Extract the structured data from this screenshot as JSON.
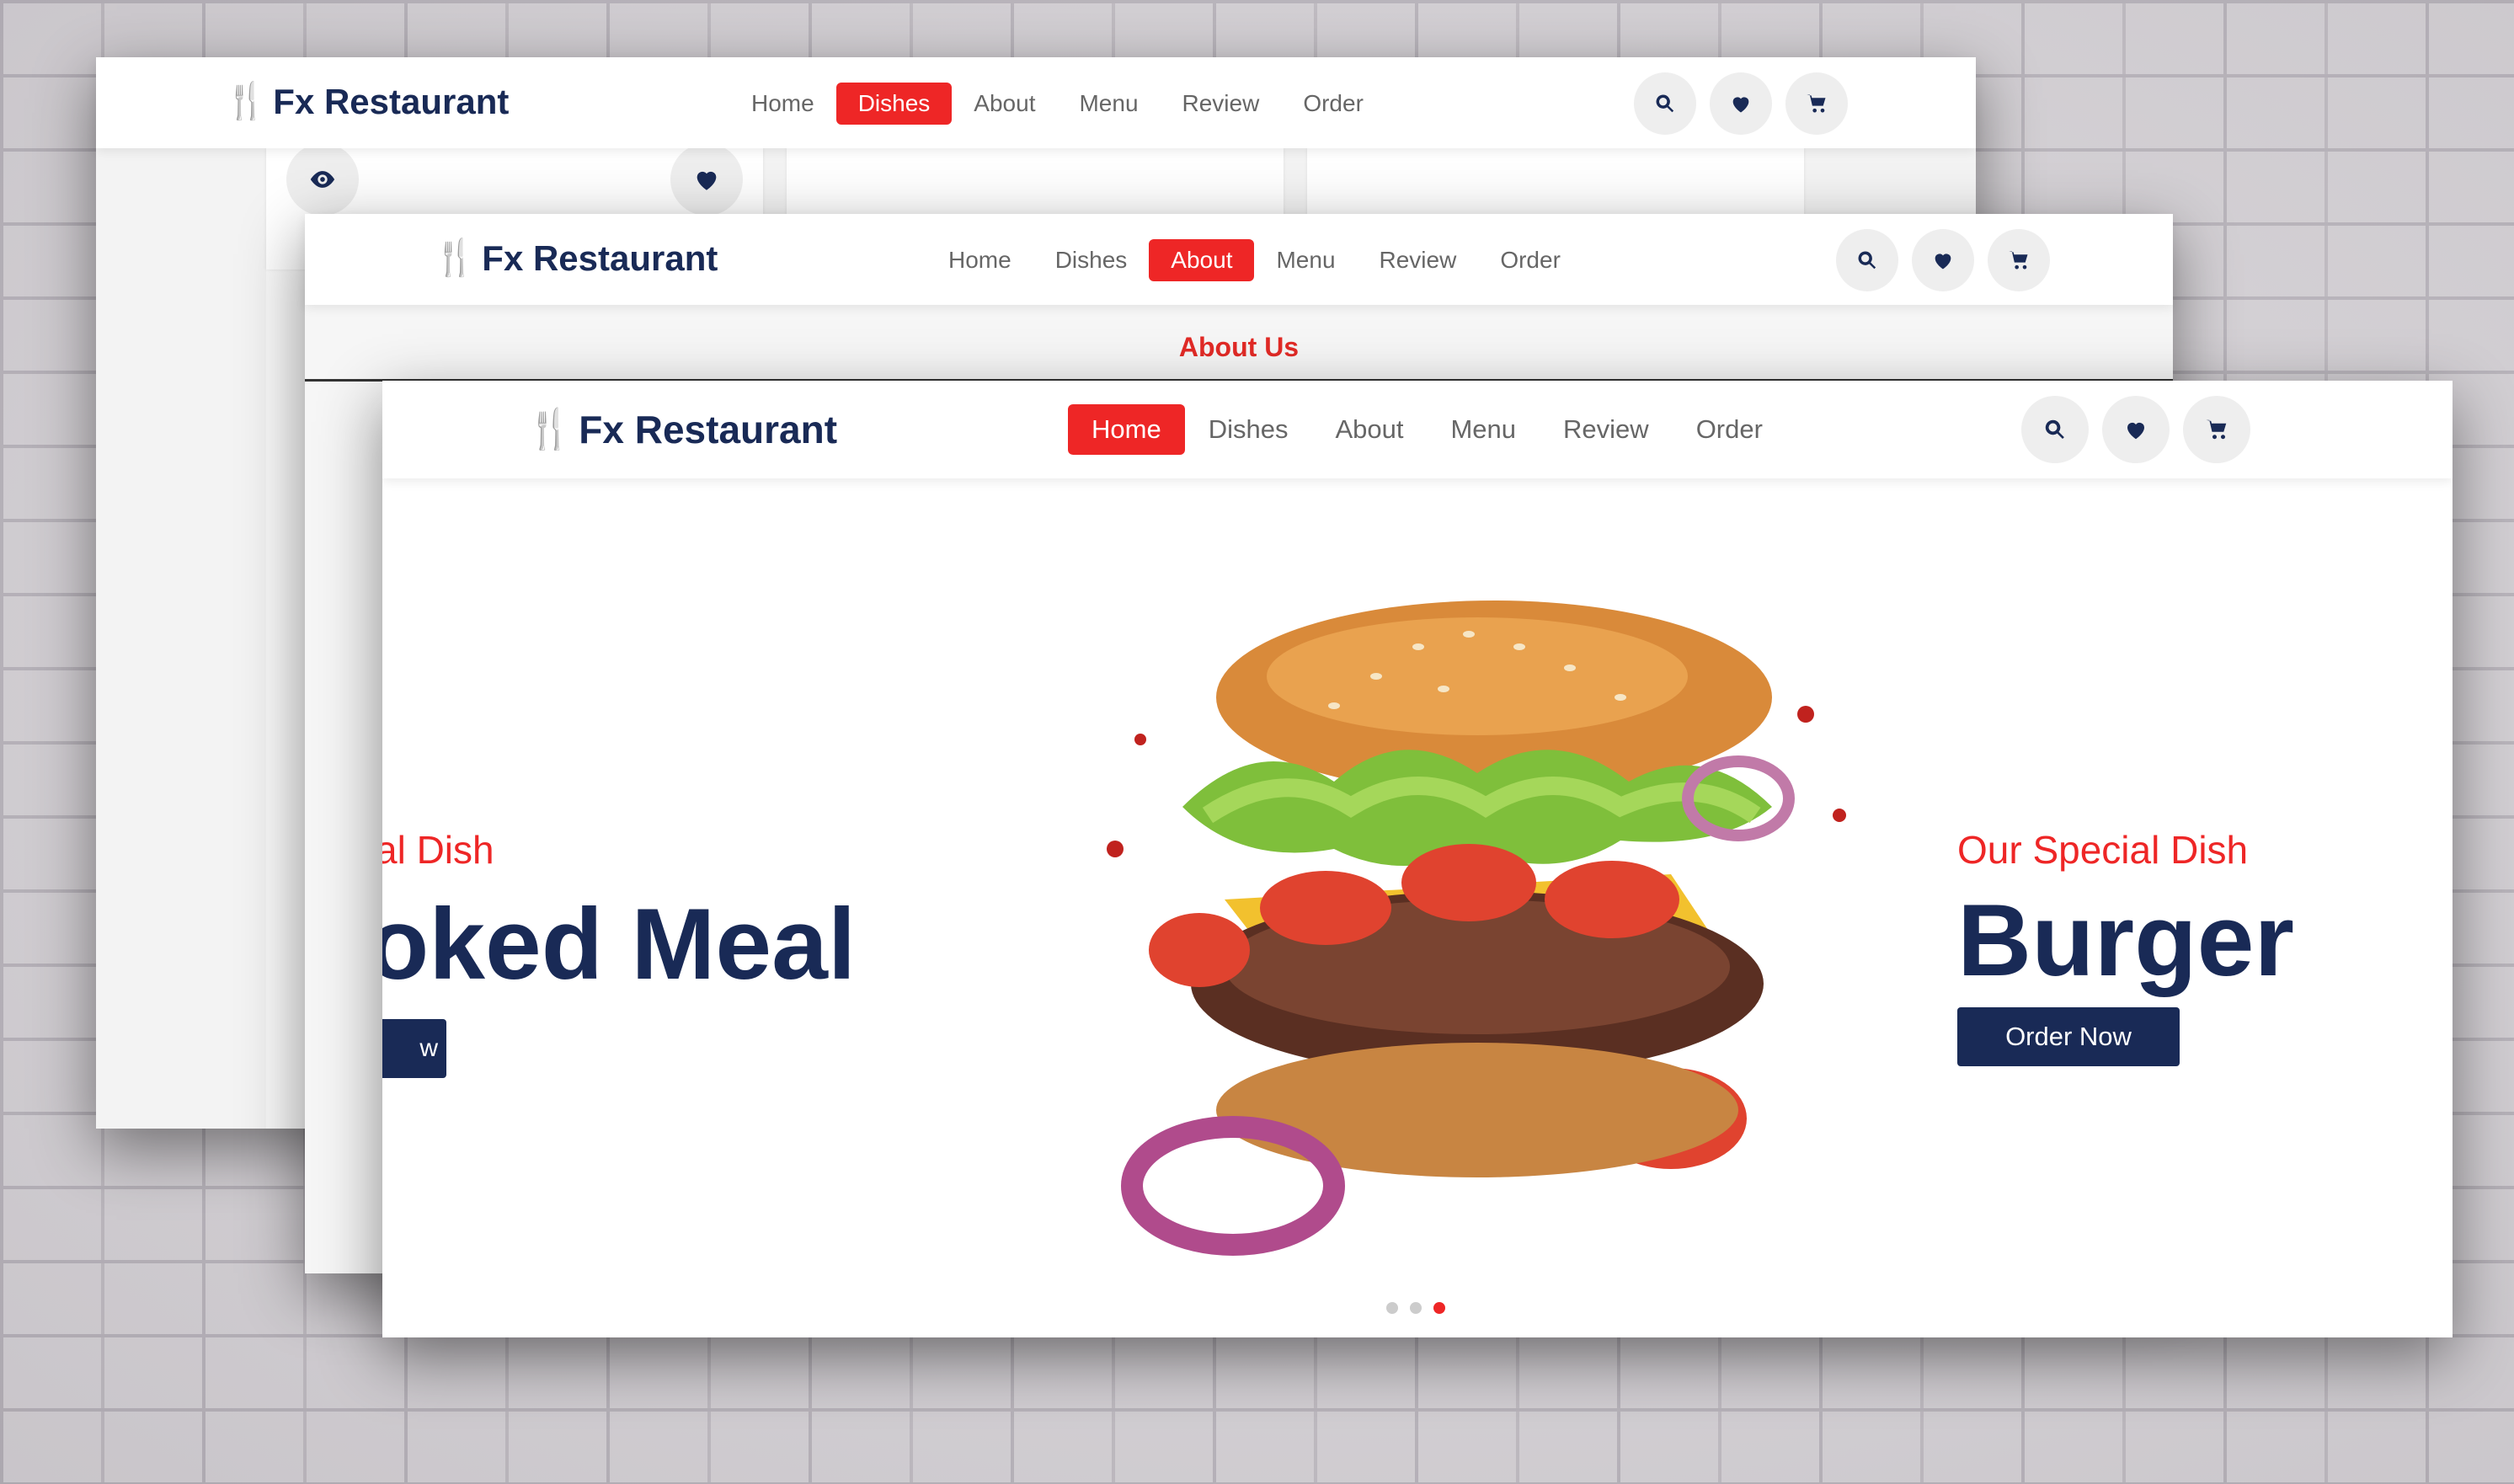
{
  "brand": {
    "name": "Fx Restaurant",
    "accent": "#ee2626",
    "dark": "#192a56"
  },
  "windows": {
    "back": {
      "nav": [
        "Home",
        "Dishes",
        "About",
        "Menu",
        "Review",
        "Order"
      ],
      "active": "Dishes"
    },
    "mid": {
      "nav": [
        "Home",
        "Dishes",
        "About",
        "Menu",
        "Review",
        "Order"
      ],
      "active": "About",
      "section_heading": "About Us"
    },
    "front": {
      "nav": [
        "Home",
        "Dishes",
        "About",
        "Menu",
        "Review",
        "Order"
      ],
      "active": "Home",
      "slide_prev": {
        "subtitle": "al Dish",
        "title": "oked Meal",
        "button": "w"
      },
      "slide_current": {
        "subtitle": "Our Special Dish",
        "title": "Burger",
        "button": "Order Now"
      },
      "slider_dots": {
        "count": 3,
        "active_index": 3
      }
    }
  },
  "icons": [
    "search-icon",
    "heart-icon",
    "cart-icon",
    "eye-icon",
    "utensils-icon"
  ]
}
